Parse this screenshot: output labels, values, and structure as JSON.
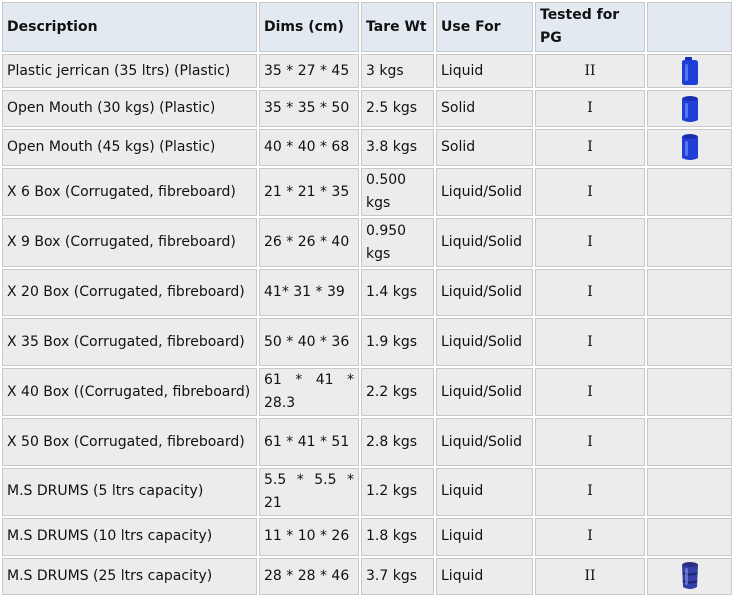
{
  "table": {
    "headers": {
      "description": "Description",
      "dims": "Dims (cm)",
      "tare": "Tare Wt",
      "use": "Use For",
      "tested": "Tested for PG",
      "image": ""
    },
    "rows": [
      {
        "description": "Plastic jerrican (35 ltrs) (Plastic)",
        "dims": "35 * 27 * 45",
        "tare": "3 kgs",
        "use": "Liquid",
        "pg": "II",
        "icon": "blue-jerrican-icon"
      },
      {
        "description": "Open Mouth (30 kgs) (Plastic)",
        "dims": "35 * 35 * 50",
        "tare": "2.5 kgs",
        "use": "Solid",
        "pg": "I",
        "icon": "blue-drum-icon"
      },
      {
        "description": "Open Mouth (45 kgs) (Plastic)",
        "dims": "40 * 40 * 68",
        "tare": "3.8 kgs",
        "use": "Solid",
        "pg": "I",
        "icon": "blue-drum-icon"
      },
      {
        "description": "X 6 Box (Corrugated, fibreboard)",
        "dims": "21 * 21 * 35",
        "tare": "0.500 kgs",
        "use": "Liquid/Solid",
        "pg": "I",
        "icon": ""
      },
      {
        "description": "X 9 Box (Corrugated, fibreboard)",
        "dims": "26 * 26 * 40",
        "tare": "0.950 kgs",
        "use": "Liquid/Solid",
        "pg": "I",
        "icon": ""
      },
      {
        "description": "X 20 Box (Corrugated, fibreboard)",
        "dims": "41* 31 * 39",
        "tare": "1.4 kgs",
        "use": "Liquid/Solid",
        "pg": "I",
        "icon": ""
      },
      {
        "description": "X 35 Box (Corrugated, fibreboard)",
        "dims": "50 * 40 * 36",
        "tare": "1.9 kgs",
        "use": "Liquid/Solid",
        "pg": "I",
        "icon": ""
      },
      {
        "description": "X 40 Box ((Corrugated, fibreboard)",
        "dims": "61 * 41 * 28.3",
        "tare": "2.2 kgs",
        "use": "Liquid/Solid",
        "pg": "I",
        "icon": ""
      },
      {
        "description": "X 50 Box (Corrugated, fibreboard)",
        "dims": "61 * 41 * 51",
        "tare": "2.8 kgs",
        "use": "Liquid/Solid",
        "pg": "I",
        "icon": ""
      },
      {
        "description": "M.S DRUMS (5 ltrs capacity)",
        "dims": "5.5 * 5.5 * 21",
        "tare": "1.2 kgs",
        "use": "Liquid",
        "pg": "I",
        "icon": ""
      },
      {
        "description": "M.S DRUMS (10 ltrs capacity)",
        "dims": "11 * 10 * 26",
        "tare": "1.8 kgs",
        "use": "Liquid",
        "pg": "I",
        "icon": ""
      },
      {
        "description": "M.S DRUMS (25 ltrs capacity)",
        "dims": "28 * 28 * 46",
        "tare": "3.7 kgs",
        "use": "Liquid",
        "pg": "II",
        "icon": "blue-metal-drum-icon"
      }
    ]
  }
}
